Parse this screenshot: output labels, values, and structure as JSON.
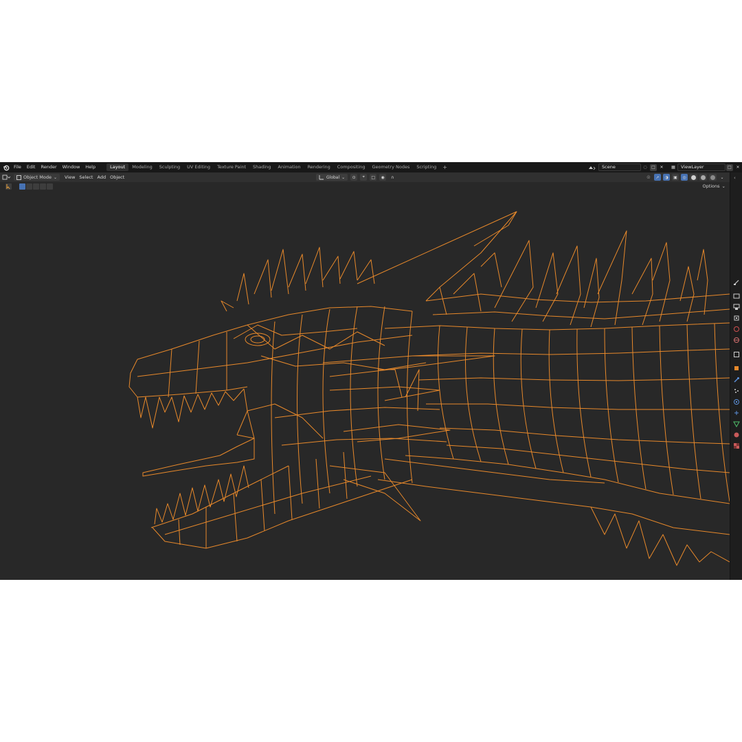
{
  "topbar": {
    "menus": [
      "File",
      "Edit",
      "Render",
      "Window",
      "Help"
    ],
    "workspaces": [
      "Layout",
      "Modeling",
      "Sculpting",
      "UV Editing",
      "Texture Paint",
      "Shading",
      "Animation",
      "Rendering",
      "Compositing",
      "Geometry Nodes",
      "Scripting"
    ],
    "active_workspace": "Layout",
    "add_tab": "+",
    "scene_name": "Scene",
    "view_layer_name": "ViewLayer"
  },
  "header": {
    "mode": "Object Mode",
    "menus": [
      "View",
      "Select",
      "Add",
      "Object"
    ],
    "transform_orientation": "Global"
  },
  "toolrow": {
    "options_label": "Options"
  },
  "icons": {
    "logo": "blender-logo-icon",
    "editor_type": "viewport-editor-icon",
    "cursor": "select-cursor-icon"
  },
  "colors": {
    "wire": "#e8892b",
    "viewport_bg": "#282828",
    "accent": "#4772b3"
  }
}
